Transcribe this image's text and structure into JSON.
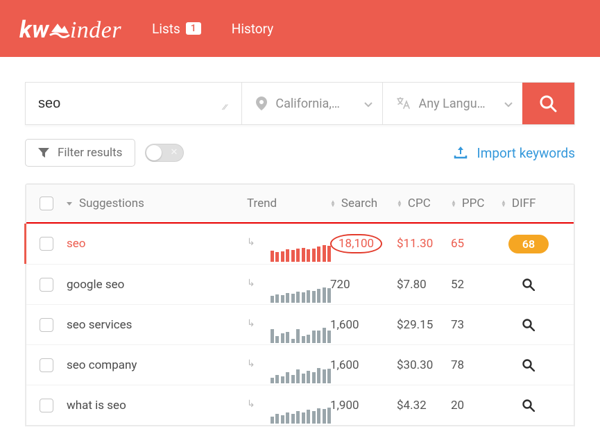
{
  "nav": {
    "lists_label": "Lists",
    "lists_count": "1",
    "history_label": "History"
  },
  "search": {
    "value": "seo",
    "location_text": "California,…",
    "language_text": "Any Langu…"
  },
  "filters": {
    "filter_label": "Filter results",
    "import_label": "Import keywords"
  },
  "table": {
    "headers": {
      "suggestions": "Suggestions",
      "trend": "Trend",
      "search": "Search",
      "cpc": "CPC",
      "ppc": "PPC",
      "diff": "DIFF"
    },
    "rows": [
      {
        "keyword": "seo",
        "search": "18,100",
        "cpc": "$11.30",
        "ppc": "65",
        "diff": "68",
        "active": true,
        "has_pill": true,
        "circled_search": true,
        "spark": [
          16,
          14,
          15,
          18,
          17,
          19,
          20,
          18,
          19,
          22,
          24,
          23
        ]
      },
      {
        "keyword": "google seo",
        "search": "720",
        "cpc": "$7.80",
        "ppc": "52",
        "spark": [
          10,
          12,
          11,
          14,
          13,
          16,
          15,
          18,
          17,
          20,
          22,
          21
        ]
      },
      {
        "keyword": "seo services",
        "search": "1,600",
        "cpc": "$29.15",
        "ppc": "73",
        "spark": [
          20,
          10,
          14,
          16,
          6,
          20,
          10,
          12,
          18,
          18,
          22,
          18
        ]
      },
      {
        "keyword": "seo company",
        "search": "1,600",
        "cpc": "$30.30",
        "ppc": "78",
        "spark": [
          8,
          12,
          10,
          16,
          12,
          20,
          14,
          18,
          16,
          22,
          20,
          21
        ]
      },
      {
        "keyword": "what is seo",
        "search": "1,900",
        "cpc": "$4.32",
        "ppc": "20",
        "spark": [
          10,
          14,
          12,
          16,
          14,
          18,
          16,
          20,
          18,
          22,
          21,
          23
        ]
      }
    ]
  }
}
